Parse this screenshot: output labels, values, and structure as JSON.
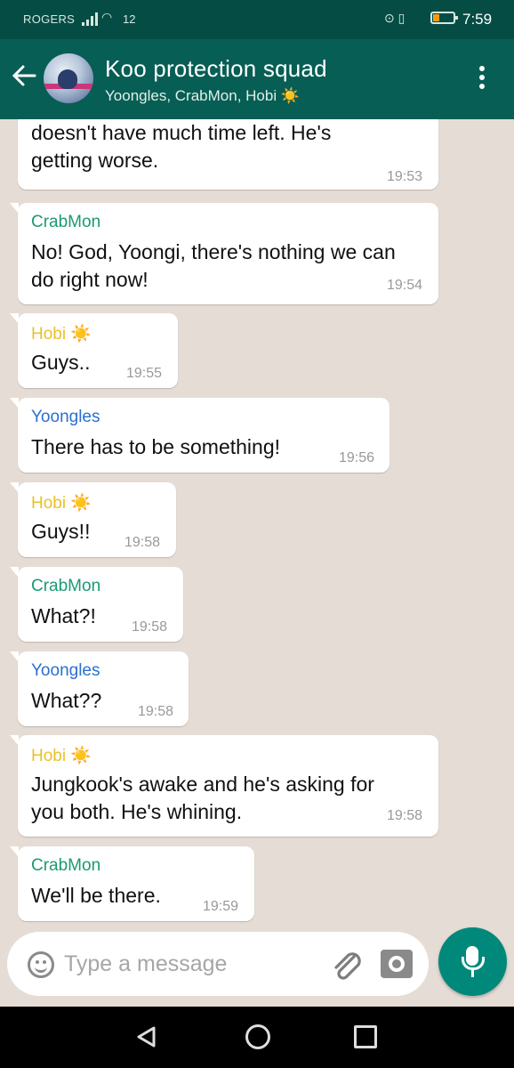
{
  "status_bar": {
    "carrier": "ROGERS",
    "network_number": "12",
    "time": "7:59",
    "battery_level_percent": 20
  },
  "header": {
    "title": "Koo protection squad",
    "subtitle": "Yoongles, CrabMon, Hobi ☀️",
    "back_icon": "arrow-left-icon",
    "menu_icon": "more-vertical-icon"
  },
  "colors": {
    "header_bg": "#075e54",
    "status_bg": "#054d44",
    "chat_bg": "#e5ddd5",
    "crabmon": "#1a9a74",
    "yoongles": "#2a6fd1",
    "hobi": "#e9c12b",
    "fab": "#00897b"
  },
  "messages": [
    {
      "sender": "",
      "text": "about why he left for so long, Junghyun\ndoesn't have much time left. He's\ngetting worse.",
      "time": "19:53"
    },
    {
      "sender": "CrabMon",
      "text": "No! God, Yoongi, there's nothing we can\ndo right now!",
      "time": "19:54"
    },
    {
      "sender": "Hobi ☀️",
      "text": "Guys..",
      "time": "19:55"
    },
    {
      "sender": "Yoongles",
      "text": "There has to be something!",
      "time": "19:56"
    },
    {
      "sender": "Hobi ☀️",
      "text": "Guys!!",
      "time": "19:58"
    },
    {
      "sender": "CrabMon",
      "text": "What?!",
      "time": "19:58"
    },
    {
      "sender": "Yoongles",
      "text": "What??",
      "time": "19:58"
    },
    {
      "sender": "Hobi ☀️",
      "text": "Jungkook's awake and he's asking for\nyou both. He's whining.",
      "time": "19:58"
    },
    {
      "sender": "CrabMon",
      "text": "We'll be there.",
      "time": "19:59"
    }
  ],
  "input": {
    "placeholder": "Type a message",
    "emoji_icon": "emoji-icon",
    "attach_icon": "paperclip-icon",
    "camera_icon": "camera-icon",
    "mic_icon": "microphone-icon"
  }
}
